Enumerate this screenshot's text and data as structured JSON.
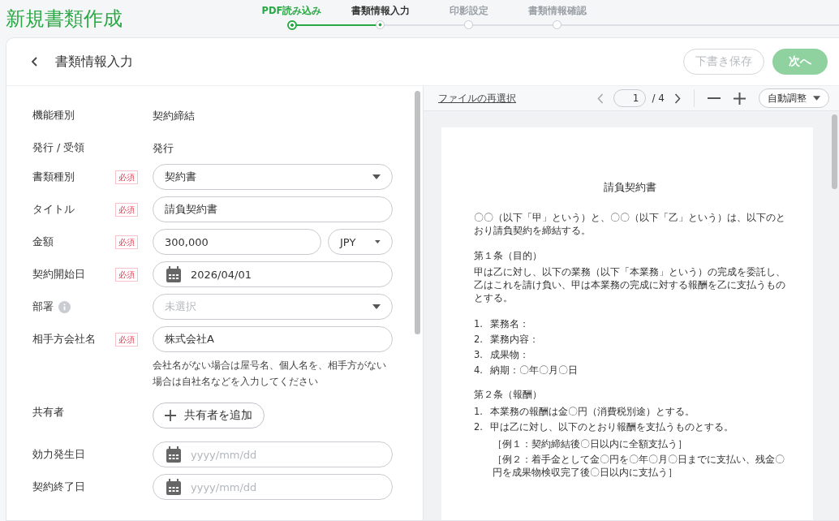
{
  "page_title": "新規書類作成",
  "steps": [
    {
      "label": "PDF読み込み",
      "completed": true,
      "selected": false
    },
    {
      "label": "書類情報入力",
      "completed": false,
      "selected": true
    },
    {
      "label": "印影設定",
      "completed": false,
      "selected": false
    },
    {
      "label": "書類情報確認",
      "completed": false,
      "selected": false
    }
  ],
  "header": {
    "title": "書類情報入力",
    "draft_button": {
      "label": "下書き保存",
      "disabled": true
    },
    "next_button": {
      "label": "次へ",
      "disabled": true
    }
  },
  "fields": [
    {
      "label": "機能種別",
      "kind": "static",
      "value": "契約締結"
    },
    {
      "label": "発行 / 受領",
      "kind": "static",
      "value": "発行"
    },
    {
      "label": "書類種別",
      "badge": "必須",
      "kind": "select",
      "value": "契約書"
    },
    {
      "label": "タイトル",
      "badge": "必須",
      "kind": "text",
      "value": "請負契約書"
    },
    {
      "label": "金額",
      "badge": "必須",
      "kind": "amount",
      "value": "300,000",
      "currency": "JPY"
    },
    {
      "label": "契約開始日",
      "badge": "必須",
      "kind": "date",
      "value": "2026/04/01"
    },
    {
      "label": "部署",
      "info": true,
      "kind": "select",
      "placeholder": "未選択"
    },
    {
      "label": "相手方会社名",
      "badge": "必須",
      "kind": "text",
      "value": "株式会社A",
      "help": "会社名がない場合は屋号名、個人名を、相手方がない場合は自社名などを入力してください"
    },
    {
      "label": "共有者",
      "kind": "add",
      "button": "共有者を追加"
    },
    {
      "label": "効力発生日",
      "kind": "date",
      "placeholder": "yyyy/mm/dd"
    },
    {
      "label": "契約終了日",
      "kind": "date",
      "placeholder": "yyyy/mm/dd"
    }
  ],
  "viewer": {
    "reselect_link": "ファイルの再選択",
    "page": "1",
    "page_total": "/ 4",
    "zoom": "自動調整",
    "document": {
      "title": "請負契約書",
      "blocks": [
        {
          "kind": "para",
          "text": "〇〇（以下「甲」という）と、〇〇（以下「乙」という）は、以下のとおり請負契約を締結する。"
        },
        {
          "kind": "heading",
          "text": "第１条（目的）"
        },
        {
          "kind": "para",
          "text": "甲は乙に対し、以下の業務（以下「本業務」という）の完成を委託し、乙はこれを請け負い、甲は本業務の完成に対する報酬を乙に支払うものとする。"
        },
        {
          "kind": "list",
          "items": [
            {
              "num": "1.",
              "text": "業務名："
            },
            {
              "num": "2.",
              "text": "業務内容："
            },
            {
              "num": "3.",
              "text": "成果物："
            },
            {
              "num": "4.",
              "text": "納期：〇年〇月〇日"
            }
          ]
        },
        {
          "kind": "heading",
          "text": "第２条（報酬）"
        },
        {
          "kind": "list",
          "items": [
            {
              "num": "1.",
              "text": "本業務の報酬は金〇円（消費税別途）とする。"
            },
            {
              "num": "2.",
              "text": "甲は乙に対し、以下のとおり報酬を支払うものとする。"
            }
          ]
        },
        {
          "kind": "note",
          "text": "［例１：契約締結後〇日以内に全額支払う］"
        },
        {
          "kind": "note",
          "text": "［例２：着手金として金〇円を〇年〇月〇日までに支払い、残金〇円を成果物検収完了後〇日以内に支払う］"
        }
      ]
    }
  }
}
